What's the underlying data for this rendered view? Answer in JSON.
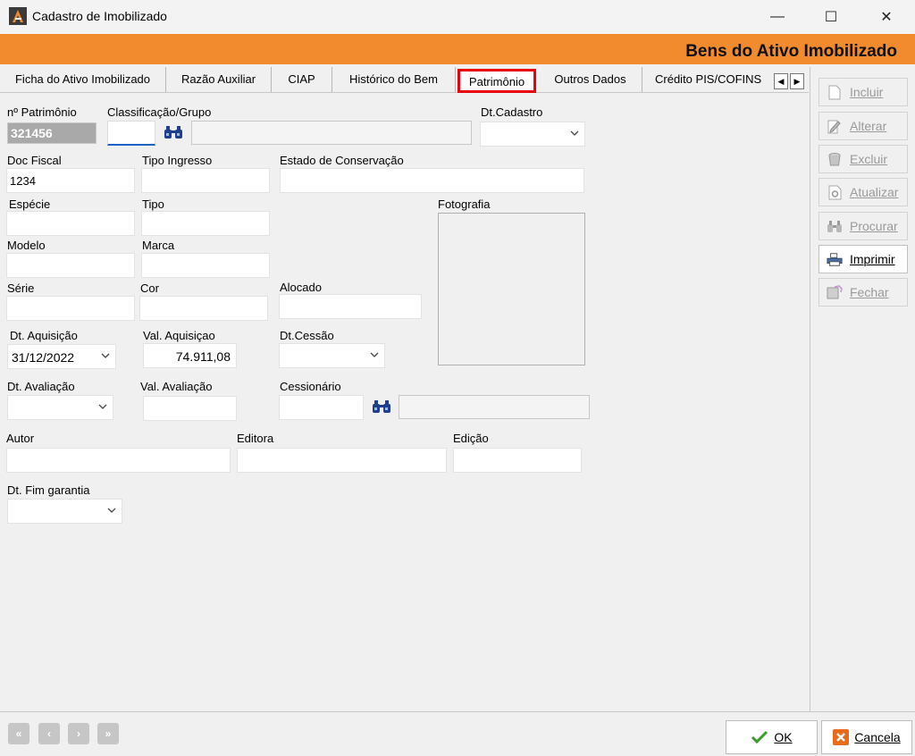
{
  "window": {
    "title": "Cadastro de Imobilizado",
    "header_title": "Bens do Ativo Imobilizado",
    "minimize_glyph": "—",
    "maximize_glyph": "☐",
    "close_glyph": "✕"
  },
  "tabs": [
    {
      "label": "Ficha do Ativo Imobilizado"
    },
    {
      "label": "Razão Auxiliar"
    },
    {
      "label": "CIAP"
    },
    {
      "label": "Histórico do Bem"
    },
    {
      "label": "Patrimônio",
      "active": true
    },
    {
      "label": "Outros Dados"
    },
    {
      "label": "Crédito PIS/COFINS"
    }
  ],
  "tab_scroll": {
    "left": "◀",
    "right": "▶"
  },
  "toolbar": {
    "incluir": "Incluir",
    "alterar": "Alterar",
    "excluir": "Excluir",
    "atualizar": "Atualizar",
    "procurar": "Procurar",
    "imprimir": "Imprimir",
    "fechar": "Fechar"
  },
  "form": {
    "n_patrimonio": {
      "label": "nº Patrimônio",
      "value": "321456"
    },
    "classificacao": {
      "label": "Classificação/Grupo",
      "value": "",
      "description": ""
    },
    "dt_cadastro": {
      "label": "Dt.Cadastro",
      "value": ""
    },
    "doc_fiscal": {
      "label": "Doc Fiscal",
      "value": "1234"
    },
    "tipo_ingresso": {
      "label": "Tipo Ingresso",
      "value": ""
    },
    "estado_conservacao": {
      "label": "Estado de Conservação",
      "value": ""
    },
    "especie": {
      "label": "Espécie",
      "value": ""
    },
    "tipo": {
      "label": "Tipo",
      "value": ""
    },
    "fotografia": {
      "label": "Fotografia"
    },
    "modelo": {
      "label": "Modelo",
      "value": ""
    },
    "marca": {
      "label": "Marca",
      "value": ""
    },
    "serie": {
      "label": "Série",
      "value": ""
    },
    "cor": {
      "label": "Cor",
      "value": ""
    },
    "alocado": {
      "label": "Alocado",
      "value": ""
    },
    "dt_aquisicao": {
      "label": "Dt. Aquisição",
      "value": "31/12/2022"
    },
    "val_aquisicao": {
      "label": "Val. Aquisiçao",
      "value": "74.911,08"
    },
    "dt_cessao": {
      "label": "Dt.Cessão",
      "value": ""
    },
    "dt_avaliacao": {
      "label": "Dt. Avaliação",
      "value": ""
    },
    "val_avaliacao": {
      "label": "Val. Avaliação",
      "value": ""
    },
    "cessionario": {
      "label": "Cessionário",
      "value": "",
      "description": ""
    },
    "autor": {
      "label": "Autor",
      "value": ""
    },
    "editora": {
      "label": "Editora",
      "value": ""
    },
    "edicao": {
      "label": "Edição",
      "value": ""
    },
    "dt_fim_garantia": {
      "label": "Dt. Fim garantia",
      "value": ""
    }
  },
  "nav": {
    "first": "«",
    "prev": "‹",
    "next": "›",
    "last": "»"
  },
  "dialog": {
    "ok": "OK",
    "cancel": "Cancela"
  },
  "colors": {
    "header": "#f28a2e",
    "active_tab_border": "#e8000d",
    "binoculars": "#1e3f8f"
  }
}
